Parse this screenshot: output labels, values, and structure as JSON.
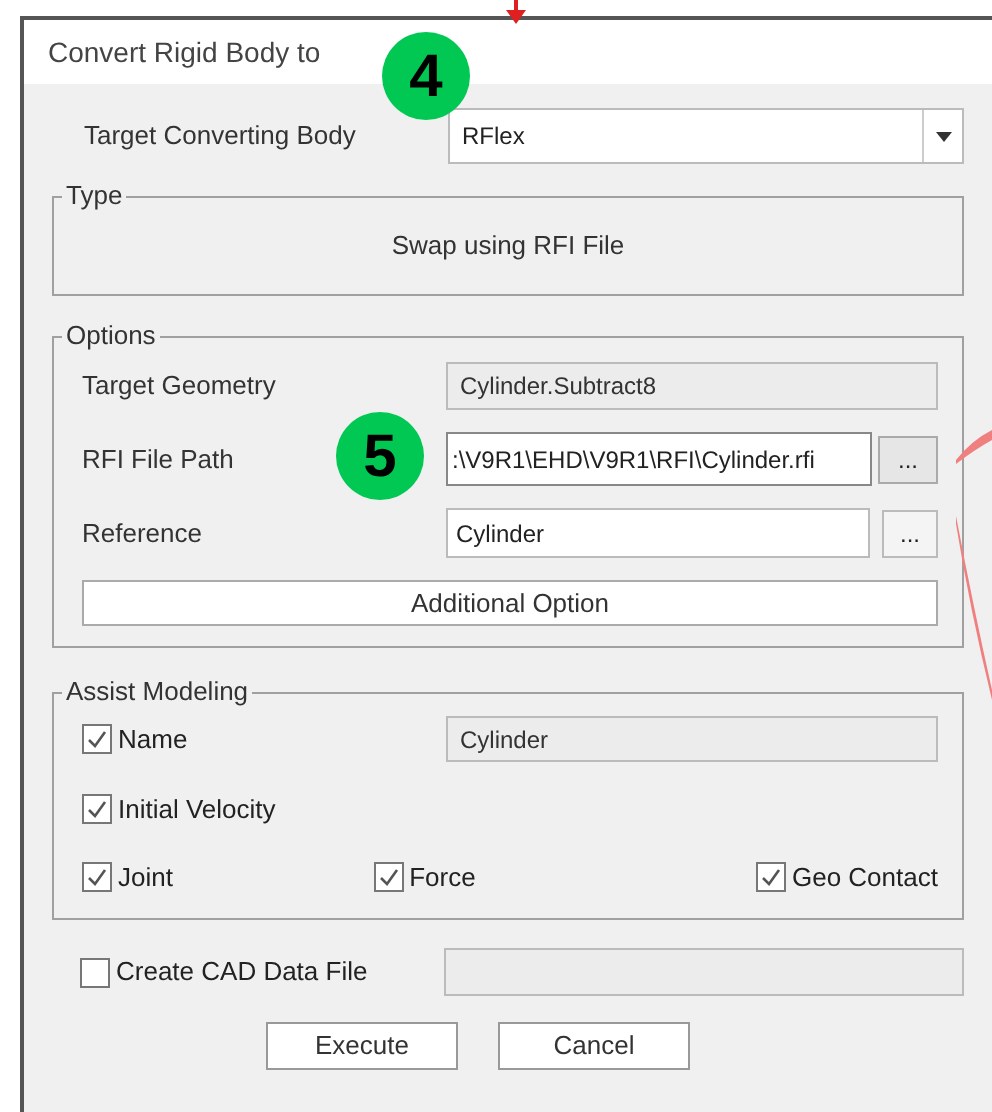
{
  "window": {
    "title": "Convert Rigid Body to"
  },
  "target_converting_body": {
    "label": "Target Converting Body",
    "value": "RFlex"
  },
  "type_group": {
    "title": "Type",
    "text": "Swap using RFI File"
  },
  "options": {
    "title": "Options",
    "target_geometry": {
      "label": "Target Geometry",
      "value": "Cylinder.Subtract8"
    },
    "rfi_file_path": {
      "label": "RFI File Path",
      "value": ":\\V9R1\\EHD\\V9R1\\RFI\\Cylinder.rfi",
      "browse": "..."
    },
    "reference": {
      "label": "Reference",
      "value": "Cylinder",
      "browse": "..."
    },
    "additional_option": "Additional Option"
  },
  "assist_modeling": {
    "title": "Assist Modeling",
    "name": {
      "label": "Name",
      "checked": true,
      "value": "Cylinder"
    },
    "initial_velocity": {
      "label": "Initial Velocity",
      "checked": true
    },
    "row": [
      {
        "label": "Joint",
        "checked": true
      },
      {
        "label": "Force",
        "checked": true
      },
      {
        "label": "Geo Contact",
        "checked": true
      }
    ]
  },
  "create_cad": {
    "label": "Create CAD Data File",
    "checked": false
  },
  "buttons": [
    "Execute",
    "Cancel"
  ],
  "badges": [
    "4",
    "5"
  ]
}
